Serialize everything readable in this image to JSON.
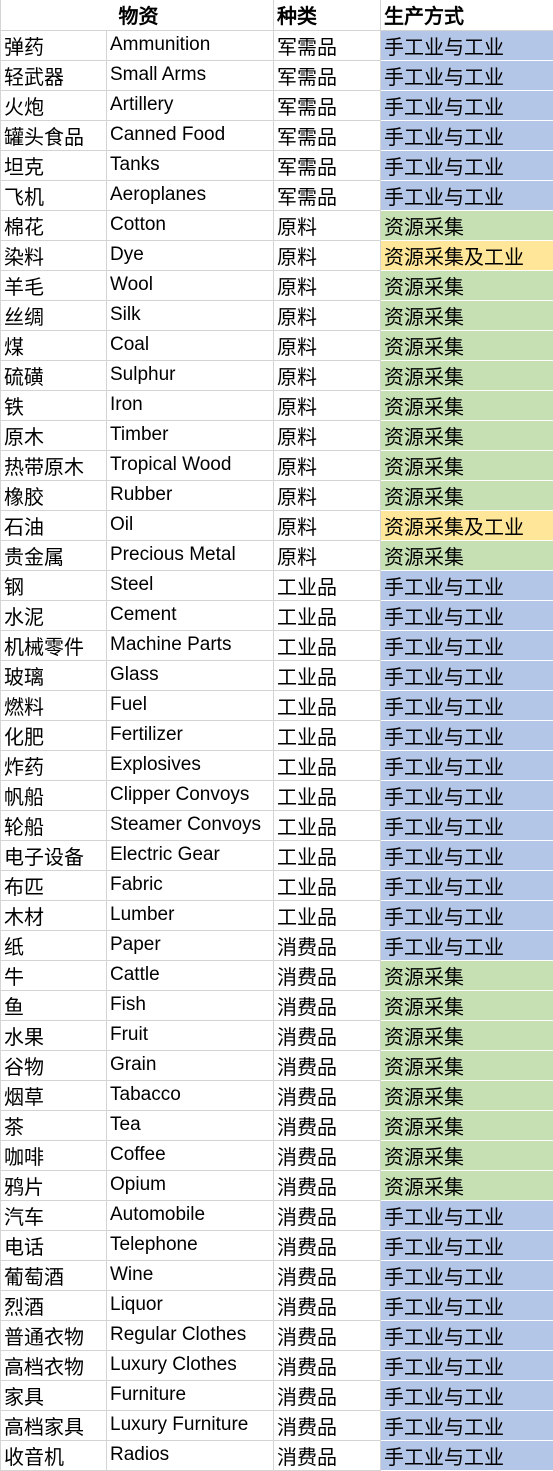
{
  "headers": {
    "item": "物资",
    "category": "种类",
    "production": "生产方式"
  },
  "colors": {
    "handicraft_industry": "#b4c6e7",
    "resource_extraction": "#c6e0b4",
    "resource_and_industry": "#ffe699"
  },
  "rows": [
    {
      "zh": "弹药",
      "en": "Ammunition",
      "cat": "军需品",
      "prod": "手工业与工业",
      "color": "blue"
    },
    {
      "zh": "轻武器",
      "en": "Small Arms",
      "cat": "军需品",
      "prod": "手工业与工业",
      "color": "blue"
    },
    {
      "zh": "火炮",
      "en": "Artillery",
      "cat": "军需品",
      "prod": "手工业与工业",
      "color": "blue"
    },
    {
      "zh": "罐头食品",
      "en": "Canned Food",
      "cat": "军需品",
      "prod": "手工业与工业",
      "color": "blue"
    },
    {
      "zh": "坦克",
      "en": "Tanks",
      "cat": "军需品",
      "prod": "手工业与工业",
      "color": "blue"
    },
    {
      "zh": "飞机",
      "en": "Aeroplanes",
      "cat": "军需品",
      "prod": "手工业与工业",
      "color": "blue"
    },
    {
      "zh": "棉花",
      "en": "Cotton",
      "cat": "原料",
      "prod": "资源采集",
      "color": "green"
    },
    {
      "zh": "染料",
      "en": "Dye",
      "cat": "原料",
      "prod": "资源采集及工业",
      "color": "orange"
    },
    {
      "zh": "羊毛",
      "en": "Wool",
      "cat": "原料",
      "prod": "资源采集",
      "color": "green"
    },
    {
      "zh": "丝绸",
      "en": "Silk",
      "cat": "原料",
      "prod": "资源采集",
      "color": "green"
    },
    {
      "zh": "煤",
      "en": "Coal",
      "cat": "原料",
      "prod": "资源采集",
      "color": "green"
    },
    {
      "zh": "硫磺",
      "en": "Sulphur",
      "cat": "原料",
      "prod": "资源采集",
      "color": "green"
    },
    {
      "zh": "铁",
      "en": "Iron",
      "cat": "原料",
      "prod": "资源采集",
      "color": "green"
    },
    {
      "zh": "原木",
      "en": "Timber",
      "cat": "原料",
      "prod": "资源采集",
      "color": "green"
    },
    {
      "zh": "热带原木",
      "en": "Tropical Wood",
      "cat": "原料",
      "prod": "资源采集",
      "color": "green"
    },
    {
      "zh": "橡胶",
      "en": "Rubber",
      "cat": "原料",
      "prod": "资源采集",
      "color": "green"
    },
    {
      "zh": "石油",
      "en": "Oil",
      "cat": "原料",
      "prod": "资源采集及工业",
      "color": "orange"
    },
    {
      "zh": "贵金属",
      "en": "Precious Metal",
      "cat": "原料",
      "prod": "资源采集",
      "color": "green"
    },
    {
      "zh": "钢",
      "en": "Steel",
      "cat": "工业品",
      "prod": "手工业与工业",
      "color": "blue"
    },
    {
      "zh": "水泥",
      "en": "Cement",
      "cat": "工业品",
      "prod": "手工业与工业",
      "color": "blue"
    },
    {
      "zh": "机械零件",
      "en": "Machine Parts",
      "cat": "工业品",
      "prod": "手工业与工业",
      "color": "blue"
    },
    {
      "zh": "玻璃",
      "en": "Glass",
      "cat": "工业品",
      "prod": "手工业与工业",
      "color": "blue"
    },
    {
      "zh": "燃料",
      "en": "Fuel",
      "cat": "工业品",
      "prod": "手工业与工业",
      "color": "blue"
    },
    {
      "zh": "化肥",
      "en": "Fertilizer",
      "cat": "工业品",
      "prod": "手工业与工业",
      "color": "blue"
    },
    {
      "zh": "炸药",
      "en": "Explosives",
      "cat": "工业品",
      "prod": "手工业与工业",
      "color": "blue"
    },
    {
      "zh": "帆船",
      "en": "Clipper Convoys",
      "cat": "工业品",
      "prod": "手工业与工业",
      "color": "blue"
    },
    {
      "zh": "轮船",
      "en": "Steamer Convoys",
      "cat": "工业品",
      "prod": "手工业与工业",
      "color": "blue"
    },
    {
      "zh": "电子设备",
      "en": "Electric Gear",
      "cat": "工业品",
      "prod": "手工业与工业",
      "color": "blue"
    },
    {
      "zh": "布匹",
      "en": "Fabric",
      "cat": "工业品",
      "prod": "手工业与工业",
      "color": "blue"
    },
    {
      "zh": "木材",
      "en": "Lumber",
      "cat": "工业品",
      "prod": "手工业与工业",
      "color": "blue"
    },
    {
      "zh": "纸",
      "en": "Paper",
      "cat": "消费品",
      "prod": "手工业与工业",
      "color": "blue"
    },
    {
      "zh": "牛",
      "en": "Cattle",
      "cat": "消费品",
      "prod": "资源采集",
      "color": "green"
    },
    {
      "zh": "鱼",
      "en": "Fish",
      "cat": "消费品",
      "prod": "资源采集",
      "color": "green"
    },
    {
      "zh": "水果",
      "en": "Fruit",
      "cat": "消费品",
      "prod": "资源采集",
      "color": "green"
    },
    {
      "zh": "谷物",
      "en": "Grain",
      "cat": "消费品",
      "prod": "资源采集",
      "color": "green"
    },
    {
      "zh": "烟草",
      "en": "Tabacco",
      "cat": "消费品",
      "prod": "资源采集",
      "color": "green"
    },
    {
      "zh": "茶",
      "en": "Tea",
      "cat": "消费品",
      "prod": "资源采集",
      "color": "green"
    },
    {
      "zh": "咖啡",
      "en": "Coffee",
      "cat": "消费品",
      "prod": "资源采集",
      "color": "green"
    },
    {
      "zh": "鸦片",
      "en": "Opium",
      "cat": "消费品",
      "prod": "资源采集",
      "color": "green"
    },
    {
      "zh": "汽车",
      "en": "Automobile",
      "cat": "消费品",
      "prod": "手工业与工业",
      "color": "blue"
    },
    {
      "zh": "电话",
      "en": "Telephone",
      "cat": "消费品",
      "prod": "手工业与工业",
      "color": "blue"
    },
    {
      "zh": "葡萄酒",
      "en": "Wine",
      "cat": "消费品",
      "prod": "手工业与工业",
      "color": "blue"
    },
    {
      "zh": "烈酒",
      "en": "Liquor",
      "cat": "消费品",
      "prod": "手工业与工业",
      "color": "blue"
    },
    {
      "zh": "普通衣物",
      "en": "Regular Clothes",
      "cat": "消费品",
      "prod": "手工业与工业",
      "color": "blue"
    },
    {
      "zh": "高档衣物",
      "en": "Luxury Clothes",
      "cat": "消费品",
      "prod": "手工业与工业",
      "color": "blue"
    },
    {
      "zh": "家具",
      "en": "Furniture",
      "cat": "消费品",
      "prod": "手工业与工业",
      "color": "blue"
    },
    {
      "zh": "高档家具",
      "en": "Luxury Furniture",
      "cat": "消费品",
      "prod": "手工业与工业",
      "color": "blue"
    },
    {
      "zh": "收音机",
      "en": "Radios",
      "cat": "消费品",
      "prod": "手工业与工业",
      "color": "blue"
    }
  ]
}
